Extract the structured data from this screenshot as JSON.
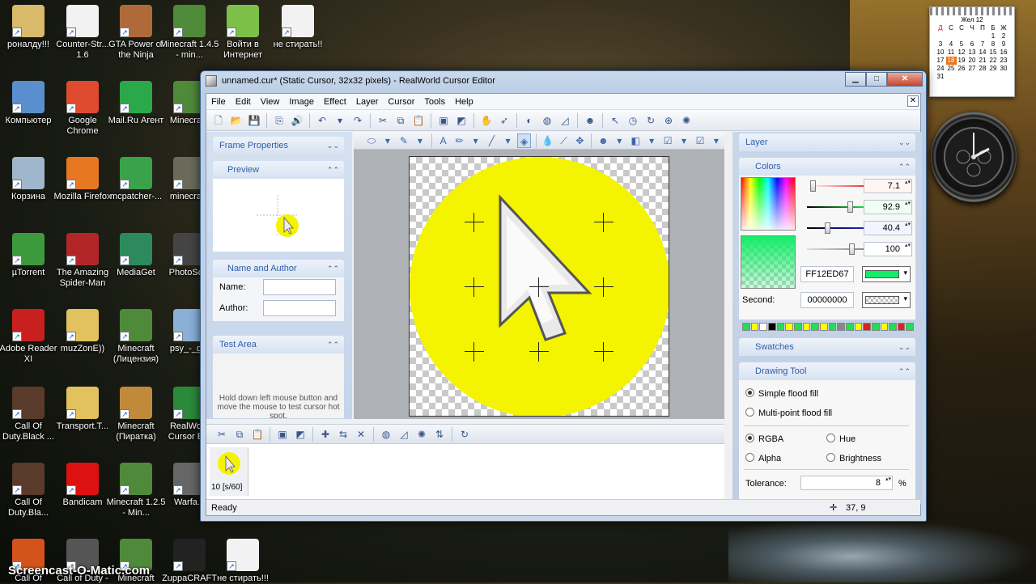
{
  "desktop": {
    "icons": [
      {
        "label": "роналду!!!",
        "col": 0,
        "row": 0,
        "color": "#d9b96a"
      },
      {
        "label": "Counter-Str... 1.6",
        "col": 1,
        "row": 0,
        "color": "#f2f2f2"
      },
      {
        "label": "GTA Power of the Ninja",
        "col": 2,
        "row": 0,
        "color": "#b06a3a"
      },
      {
        "label": "Minecraft 1.4.5 - min...",
        "col": 3,
        "row": 0,
        "color": "#4f8a3a"
      },
      {
        "label": "Войти в Интернет",
        "col": 4,
        "row": 0,
        "color": "#7cc04a"
      },
      {
        "label": "не стирать!!",
        "col": 5,
        "row": 0,
        "color": "#f2f2f2"
      },
      {
        "label": "Компьютер",
        "col": 0,
        "row": 1,
        "color": "#5a8fcf"
      },
      {
        "label": "Google Chrome",
        "col": 1,
        "row": 1,
        "color": "#e04a2f"
      },
      {
        "label": "Mail.Ru Агент",
        "col": 2,
        "row": 1,
        "color": "#2aa84a"
      },
      {
        "label": "Minecra...",
        "col": 3,
        "row": 1,
        "color": "#4f8a3a"
      },
      {
        "label": "Корзина",
        "col": 0,
        "row": 2,
        "color": "#9fb6cc"
      },
      {
        "label": "Mozilla Firefox",
        "col": 1,
        "row": 2,
        "color": "#e87722"
      },
      {
        "label": "mcpatcher-...",
        "col": 2,
        "row": 2,
        "color": "#3aa24a"
      },
      {
        "label": "minecra...",
        "col": 3,
        "row": 2,
        "color": "#6a6a5a"
      },
      {
        "label": "µTorrent",
        "col": 0,
        "row": 3,
        "color": "#3c9a3c"
      },
      {
        "label": "The Amazing Spider-Man",
        "col": 1,
        "row": 3,
        "color": "#b2262a"
      },
      {
        "label": "MediaGet",
        "col": 2,
        "row": 3,
        "color": "#2c8a5c"
      },
      {
        "label": "PhotoSc...",
        "col": 3,
        "row": 3,
        "color": "#444"
      },
      {
        "label": "Adobe Reader XI",
        "col": 0,
        "row": 4,
        "color": "#c8201f"
      },
      {
        "label": "muzZonE))",
        "col": 1,
        "row": 4,
        "color": "#e2c15f"
      },
      {
        "label": "Minecraft (Лицензия)",
        "col": 2,
        "row": 4,
        "color": "#4f8a3a"
      },
      {
        "label": "psy_-_g...",
        "col": 3,
        "row": 4,
        "color": "#8ab0d8"
      },
      {
        "label": "Call Of Duty.Black ...",
        "col": 0,
        "row": 5,
        "color": "#5a3a2a"
      },
      {
        "label": "Transport.T...",
        "col": 1,
        "row": 5,
        "color": "#e2c15f"
      },
      {
        "label": "Minecraft (Пиратка)",
        "col": 2,
        "row": 5,
        "color": "#c08a3a"
      },
      {
        "label": "RealWo... Cursor E...",
        "col": 3,
        "row": 5,
        "color": "#2a8a3a"
      },
      {
        "label": "Call Of Duty.Bla...",
        "col": 0,
        "row": 6,
        "color": "#5a3a2a"
      },
      {
        "label": "Bandicam",
        "col": 1,
        "row": 6,
        "color": "#d11"
      },
      {
        "label": "Minecraft 1.2.5 - Min...",
        "col": 2,
        "row": 6,
        "color": "#4f8a3a"
      },
      {
        "label": "Warfa...",
        "col": 3,
        "row": 6,
        "color": "#666"
      },
      {
        "label": "Call Of",
        "col": 0,
        "row": 7,
        "color": "#d4531a"
      },
      {
        "label": "Call of Duty -",
        "col": 1,
        "row": 7,
        "color": "#555"
      },
      {
        "label": "Minecraft",
        "col": 2,
        "row": 7,
        "color": "#4f8a3a"
      },
      {
        "label": "ZuppaCRAFT",
        "col": 3,
        "row": 7,
        "color": "#222"
      },
      {
        "label": "не стирать!!!",
        "col": 4,
        "row": 7,
        "color": "#f2f2f2"
      }
    ],
    "watermark": "Screencast-O-Matic.com"
  },
  "calendar": {
    "month": "Жел 12",
    "weekdays": [
      "Д",
      "С",
      "С",
      "Ч",
      "П",
      "Б",
      "Ж"
    ],
    "rows": [
      [
        "",
        "",
        "",
        "",
        "",
        "1",
        "2"
      ],
      [
        "3",
        "4",
        "5",
        "6",
        "7",
        "8",
        "9"
      ],
      [
        "10",
        "11",
        "12",
        "13",
        "14",
        "15",
        "16"
      ],
      [
        "17",
        "18",
        "19",
        "20",
        "21",
        "22",
        "23"
      ],
      [
        "24",
        "25",
        "26",
        "27",
        "28",
        "29",
        "30"
      ],
      [
        "31",
        "",
        "",
        "",
        "",
        "",
        ""
      ]
    ],
    "today": "18"
  },
  "window": {
    "title": "unnamed.cur* (Static Cursor, 32x32 pixels) - RealWorld Cursor Editor",
    "buttons": {
      "minimize": "▁",
      "maximize": "□",
      "close": "✕"
    },
    "menu": [
      "File",
      "Edit",
      "View",
      "Image",
      "Effect",
      "Layer",
      "Cursor",
      "Tools",
      "Help"
    ],
    "mdi_close": "✕"
  },
  "left_pane": {
    "frame_properties": "Frame Properties",
    "preview": "Preview",
    "name_author": "Name and Author",
    "name_label": "Name:",
    "author_label": "Author:",
    "name_value": "",
    "author_value": "",
    "test_area": "Test Area",
    "test_hint": "Hold down left mouse button and move the mouse to test cursor hot spot."
  },
  "right_pane": {
    "layer": "Layer",
    "colors": "Colors",
    "slider_values": [
      "7.1",
      "92.9",
      "40.4",
      "100"
    ],
    "hex_value": "FF12ED67",
    "primary_color": "#12ed67",
    "second_label": "Second:",
    "second_value": "00000000",
    "palette": [
      "#22dd55",
      "#ffff00",
      "#ffffff",
      "#000000",
      "#22dd55",
      "#ffff00",
      "#22dd55",
      "#ffff00",
      "#22dd55",
      "#ffff00",
      "#22dd55",
      "#888888",
      "#22dd55",
      "#ffff00",
      "#dd2222",
      "#22dd55",
      "#ffff00",
      "#22dd55",
      "#dd2222",
      "#22dd55"
    ],
    "swatches": "Swatches",
    "drawing_tool": "Drawing Tool",
    "simple_fill": "Simple flood fill",
    "multi_fill": "Multi-point flood fill",
    "rgba": "RGBA",
    "hue": "Hue",
    "alpha": "Alpha",
    "brightness": "Brightness",
    "tolerance_label": "Tolerance:",
    "tolerance_value": "8",
    "tolerance_unit": "%"
  },
  "frames": {
    "frame_label": "10 [s/60]"
  },
  "status": {
    "text": "Ready",
    "coords": "37, 9"
  }
}
